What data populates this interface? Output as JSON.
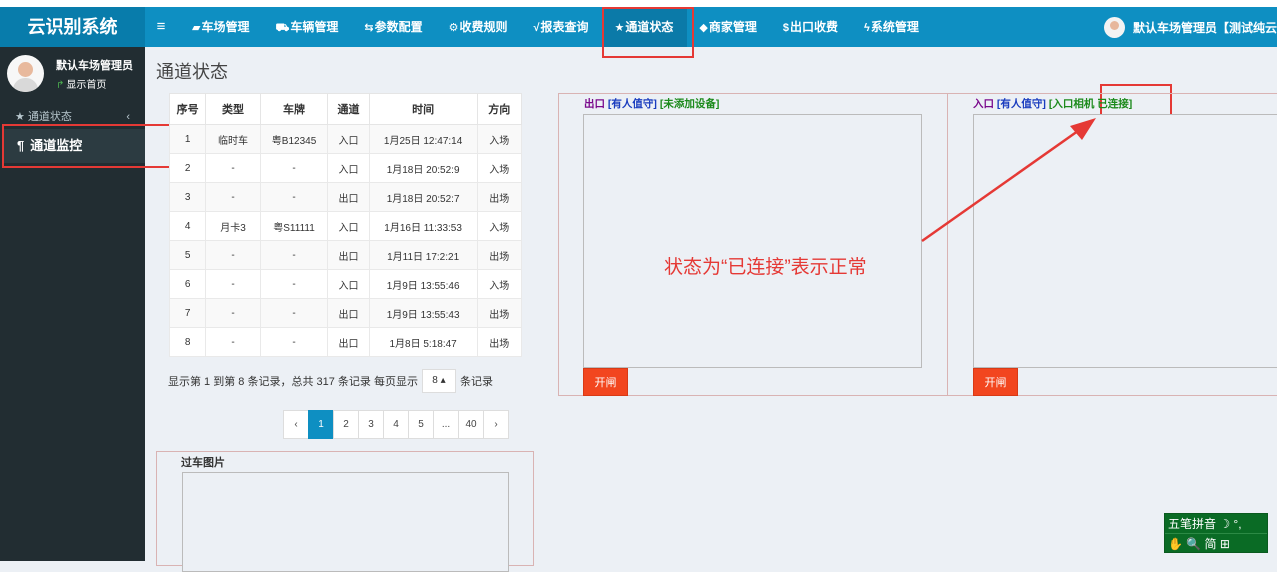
{
  "app": {
    "title": "云识别系统"
  },
  "colors": {
    "topbar": "#0e8fc2",
    "sidebar": "#222d32",
    "accent": "#f2461f",
    "annotation": "#e53935"
  },
  "topnav": {
    "toggle_icon": "hamburger-icon",
    "items": [
      {
        "icon": "card-icon",
        "glyph": "▰",
        "label": "车场管理"
      },
      {
        "icon": "car-icon",
        "glyph": "⛟",
        "label": "车辆管理"
      },
      {
        "icon": "sliders-icon",
        "glyph": "⇆",
        "label": "参数配置"
      },
      {
        "icon": "gears-icon",
        "glyph": "⚙",
        "label": "收费规则"
      },
      {
        "icon": "chart-icon",
        "glyph": "√",
        "label": "报表查询"
      },
      {
        "icon": "star-icon",
        "glyph": "★",
        "label": "通道状态"
      },
      {
        "icon": "tag-icon",
        "glyph": "◆",
        "label": "商家管理"
      },
      {
        "icon": "yen-icon",
        "glyph": "$",
        "label": "出口收费"
      },
      {
        "icon": "wrench-icon",
        "glyph": "ϟ",
        "label": "系统管理"
      }
    ],
    "active_label": "通道状态",
    "user": "默认车场管理员【测试纯云平"
  },
  "sidebar": {
    "user_name": "默认车场管理员",
    "home_link": "显示首页",
    "section": "通道状态",
    "item": "通道监控"
  },
  "page": {
    "title": "通道状态"
  },
  "records": {
    "columns": [
      "序号",
      "类型",
      "车牌",
      "通道",
      "时间",
      "方向"
    ],
    "rows": [
      [
        "1",
        "临时车",
        "粤B12345",
        "入口",
        "1月25日 12:47:14",
        "入场"
      ],
      [
        "2",
        "-",
        "-",
        "入口",
        "1月18日 20:52:9",
        "入场"
      ],
      [
        "3",
        "-",
        "-",
        "出口",
        "1月18日 20:52:7",
        "出场"
      ],
      [
        "4",
        "月卡3",
        "粤S11111",
        "入口",
        "1月16日 11:33:53",
        "入场"
      ],
      [
        "5",
        "-",
        "-",
        "出口",
        "1月11日 17:2:21",
        "出场"
      ],
      [
        "6",
        "-",
        "-",
        "入口",
        "1月9日 13:55:46",
        "入场"
      ],
      [
        "7",
        "-",
        "-",
        "出口",
        "1月9日 13:55:43",
        "出场"
      ],
      [
        "8",
        "-",
        "-",
        "出口",
        "1月8日 5:18:47",
        "出场"
      ]
    ]
  },
  "pager": {
    "info_prefix": "显示第 1 到第 8 条记录，总共 317 条记录 每页显示",
    "per_page": "8 ▴",
    "info_suffix": "条记录",
    "pages": [
      "‹",
      "1",
      "2",
      "3",
      "4",
      "5",
      "...",
      "40",
      "›"
    ],
    "current": "1"
  },
  "photo_panel": {
    "title": "过车图片"
  },
  "exit_lane": {
    "name": "出口",
    "duty": "[有人值守]",
    "device": "[未添加设备]",
    "button": "开闸"
  },
  "entry_lane": {
    "name": "入口",
    "duty": "[有人值守]",
    "device": "[入口相机",
    "status": "已连接]",
    "button": "开闸"
  },
  "annotation": {
    "note": "状态为“已连接”表示正常"
  },
  "ime": {
    "row1": "五笔拼音 ☽ °,",
    "row2": "✋ 🔍 简 ⊞"
  }
}
